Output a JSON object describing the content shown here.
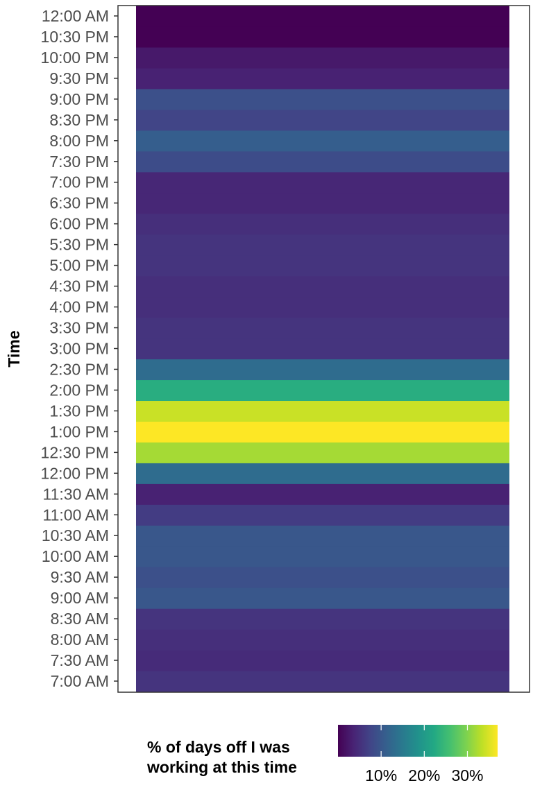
{
  "chart_data": {
    "type": "heatmap",
    "ylabel": "Time",
    "y": [
      "7:00 AM",
      "7:30 AM",
      "8:00 AM",
      "8:30 AM",
      "9:00 AM",
      "9:30 AM",
      "10:00 AM",
      "10:30 AM",
      "11:00 AM",
      "11:30 AM",
      "12:00 PM",
      "12:30 PM",
      "1:00 PM",
      "1:30 PM",
      "2:00 PM",
      "2:30 PM",
      "3:00 PM",
      "3:30 PM",
      "4:00 PM",
      "4:30 PM",
      "5:00 PM",
      "5:30 PM",
      "6:00 PM",
      "6:30 PM",
      "7:00 PM",
      "7:30 PM",
      "8:00 PM",
      "8:30 PM",
      "9:00 PM",
      "9:30 PM",
      "10:00 PM",
      "10:30 PM",
      "12:00 AM"
    ],
    "values": [
      5.5,
      4.5,
      5,
      5.5,
      10,
      9,
      10,
      10,
      6.5,
      3.5,
      13,
      32,
      37,
      34,
      23,
      13,
      5.5,
      5.5,
      5,
      5,
      5.5,
      5.5,
      5,
      4,
      4,
      8.5,
      11,
      7.5,
      9,
      3.5,
      2.5,
      0,
      0
    ],
    "value_range": [
      0,
      37
    ],
    "legend": {
      "title_lines": [
        "% of days off I was",
        "working at this time"
      ],
      "ticks": [
        10,
        20,
        30
      ],
      "tick_labels": [
        "10%",
        "20%",
        "30%"
      ],
      "position": "bottom"
    },
    "colormap": "viridis"
  }
}
